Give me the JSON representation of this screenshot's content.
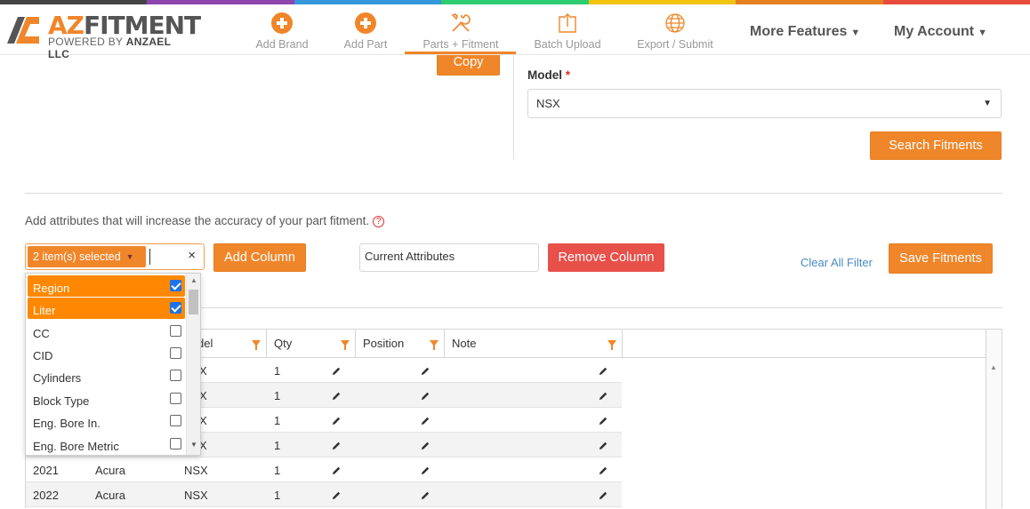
{
  "colors": {
    "accent": "#f0862a",
    "danger": "#e8504a",
    "link": "#4a8bc4"
  },
  "topbar_colors": [
    "#444444",
    "#8e44ad",
    "#3498db",
    "#2ecc71",
    "#f1c40f",
    "#e67e22",
    "#e74c3c"
  ],
  "logo": {
    "brand_az": "AZ",
    "brand_rest": "FITMENT",
    "sub_prefix": "POWERED BY ",
    "sub_bold": "ANZAEL LLC"
  },
  "nav": [
    {
      "label": "Add Brand",
      "icon": "plus-circle-icon"
    },
    {
      "label": "Add Part",
      "icon": "plus-circle-icon"
    },
    {
      "label": "Parts + Fitment",
      "icon": "tools-icon"
    },
    {
      "label": "Batch Upload",
      "icon": "upload-icon"
    },
    {
      "label": "Export / Submit",
      "icon": "globe-icon"
    }
  ],
  "menu": {
    "more_features": "More Features",
    "my_account": "My Account"
  },
  "buttons": {
    "copy": "Copy",
    "search_fitments": "Search Fitments",
    "add_column": "Add Column",
    "remove_column": "Remove Column",
    "save_fitments": "Save Fitments"
  },
  "model": {
    "label": "Model",
    "required": "*",
    "value": "NSX"
  },
  "hint": "Add attributes that will increase the accuracy of your part fitment.",
  "multiselect": {
    "tag": "2 item(s) selected",
    "clear": "×"
  },
  "current_attributes": "Current Attributes",
  "clear_all_filter": "Clear All Filter",
  "attribute_options": [
    {
      "label": "Region",
      "checked": true
    },
    {
      "label": "Liter",
      "checked": true
    },
    {
      "label": "CC",
      "checked": false
    },
    {
      "label": "CID",
      "checked": false
    },
    {
      "label": "Cylinders",
      "checked": false
    },
    {
      "label": "Block Type",
      "checked": false
    },
    {
      "label": "Eng. Bore In.",
      "checked": false
    },
    {
      "label": "Eng. Bore Metric",
      "checked": false
    }
  ],
  "grid": {
    "headers": {
      "model_partial": "del",
      "qty": "Qty",
      "position": "Position",
      "note": "Note"
    },
    "partial_rows": [
      {
        "model": "X",
        "qty": "1"
      },
      {
        "model": "X",
        "qty": "1"
      },
      {
        "model": "X",
        "qty": "1"
      },
      {
        "model": "X",
        "qty": "1"
      }
    ],
    "rows": [
      {
        "year": "2021",
        "make": "Acura",
        "model": "NSX",
        "qty": "1"
      },
      {
        "year": "2022",
        "make": "Acura",
        "model": "NSX",
        "qty": "1"
      }
    ]
  }
}
